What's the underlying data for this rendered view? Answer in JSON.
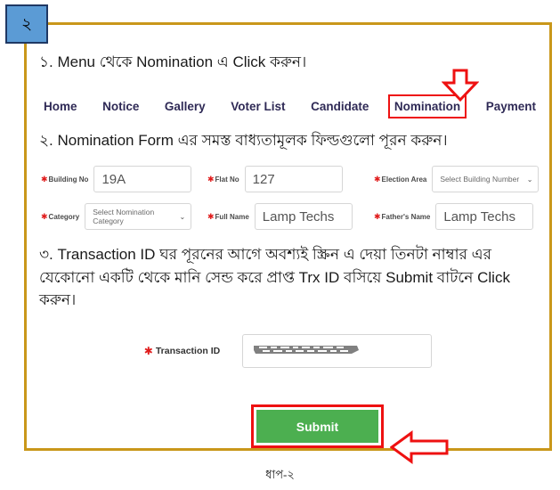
{
  "badge": {
    "number": "২"
  },
  "instructions": {
    "step1": "১. Menu থেকে Nomination এ Click করুন।",
    "step2": "২. Nomination Form এর সমস্ত বাধ্যতামূলক ফিল্ডগুলো পূরন করুন।",
    "step3": "৩. Transaction ID ঘর পূরনের আগে অবশ্যই স্ক্রিন এ দেয়া তিনটা নাম্বার এর যেকোনো একটি থেকে মানি সেন্ড করে প্রাপ্ত Trx ID বসিয়ে Submit বাটনে Click করুন।"
  },
  "nav": {
    "items": [
      {
        "label": "Home",
        "highlighted": false
      },
      {
        "label": "Notice",
        "highlighted": false
      },
      {
        "label": "Gallery",
        "highlighted": false
      },
      {
        "label": "Voter List",
        "highlighted": false
      },
      {
        "label": "Candidate",
        "highlighted": false
      },
      {
        "label": "Nomination",
        "highlighted": true
      },
      {
        "label": "Payment",
        "highlighted": false
      }
    ]
  },
  "form": {
    "row1": [
      {
        "label": "Building No",
        "required": true,
        "type": "text",
        "value": "19A"
      },
      {
        "label": "Flat No",
        "required": true,
        "type": "text",
        "value": "127"
      },
      {
        "label": "Election Area",
        "required": true,
        "type": "select",
        "value": "Select Building Number"
      }
    ],
    "row2": [
      {
        "label": "Category",
        "required": true,
        "type": "select",
        "value": "Select Nomination Category"
      },
      {
        "label": "Full Name",
        "required": true,
        "type": "text",
        "value": "Lamp Techs"
      },
      {
        "label": "Father's Name",
        "required": true,
        "type": "text",
        "value": "Lamp Techs"
      }
    ],
    "transaction": {
      "label": "Transaction ID",
      "required": true,
      "value": "",
      "redacted": true
    },
    "submit_label": "Submit"
  },
  "annotations": {
    "arrow_down_target": "Nomination",
    "arrow_left_target": "Submit",
    "highlight_color": "#ee1111"
  },
  "caption": "ধাপ-২",
  "colors": {
    "frame": "#c9971a",
    "badge_bg": "#5b9bd5",
    "badge_border": "#1f3864",
    "nav_text": "#2f2a56",
    "submit_bg": "#4caf50",
    "required_star": "#e01b1b",
    "annotation_red": "#ee1111"
  },
  "icons": {
    "chevron": "⌄",
    "star": "✱"
  }
}
